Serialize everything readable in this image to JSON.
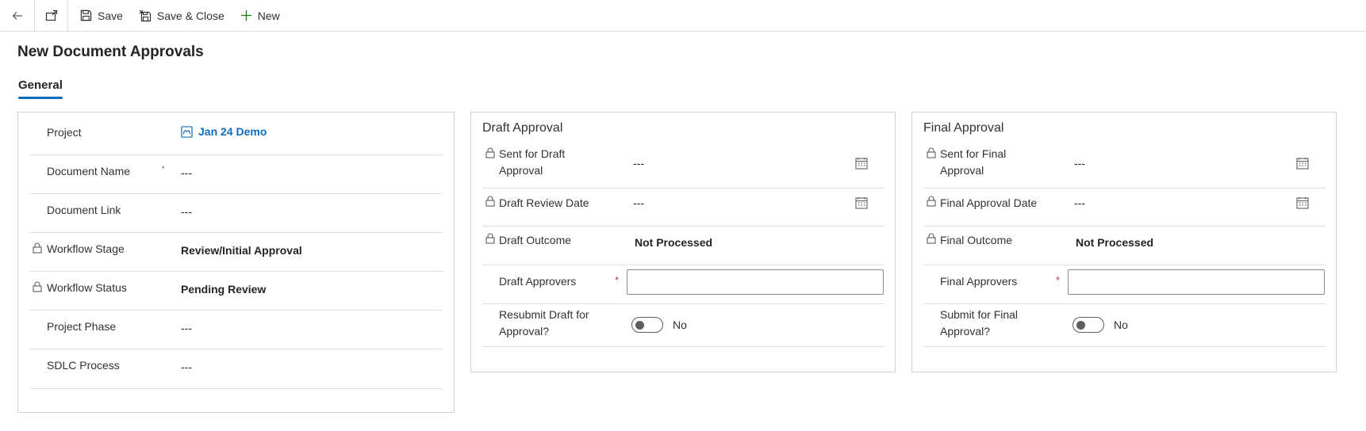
{
  "toolbar": {
    "save": "Save",
    "save_close": "Save & Close",
    "new": "New"
  },
  "page": {
    "title": "New Document Approvals",
    "tab": "General"
  },
  "general": {
    "project_label": "Project",
    "project_value": "Jan 24 Demo",
    "document_name_label": "Document Name",
    "document_name_value": "---",
    "document_link_label": "Document Link",
    "document_link_value": "---",
    "workflow_stage_label": "Workflow Stage",
    "workflow_stage_value": "Review/Initial Approval",
    "workflow_status_label": "Workflow Status",
    "workflow_status_value": "Pending Review",
    "project_phase_label": "Project Phase",
    "project_phase_value": "---",
    "sdlc_label": "SDLC Process",
    "sdlc_value": "---",
    "required_marker": "*"
  },
  "draft": {
    "title": "Draft Approval",
    "sent_label_1": "Sent for Draft",
    "sent_label_2": "Approval",
    "sent_value": "---",
    "review_date_label": "Draft Review Date",
    "review_date_value": "---",
    "outcome_label": "Draft Outcome",
    "outcome_value": "Not Processed",
    "approvers_label": "Draft Approvers",
    "approvers_value": "",
    "resubmit_label_1": "Resubmit Draft for",
    "resubmit_label_2": "Approval?",
    "resubmit_value": "No",
    "required_marker": "*"
  },
  "final": {
    "title": "Final Approval",
    "sent_label_1": "Sent for Final",
    "sent_label_2": "Approval",
    "sent_value": "---",
    "approval_date_label": "Final Approval Date",
    "approval_date_value": "---",
    "outcome_label": "Final Outcome",
    "outcome_value": "Not Processed",
    "approvers_label": "Final Approvers",
    "approvers_value": "",
    "submit_label_1": "Submit for Final",
    "submit_label_2": "Approval?",
    "submit_value": "No",
    "required_marker": "*"
  },
  "icons": {
    "back": "back-arrow-icon",
    "popout": "popout-icon",
    "save": "save-icon",
    "save_close": "save-close-icon",
    "new": "plus-icon",
    "lock": "lock-icon",
    "calendar": "calendar-icon",
    "entity": "project-entity-icon"
  },
  "colors": {
    "accent": "#0f6cbd",
    "required": "#c4314b",
    "new_icon": "#107c10"
  }
}
